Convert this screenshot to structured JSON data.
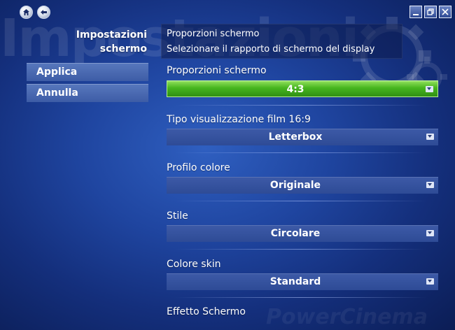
{
  "window": {
    "watermark": "Impostazioni",
    "brand": "PowerCinema"
  },
  "sidebar": {
    "title_line1": "Impostazioni",
    "title_line2": "schermo",
    "apply_label": "Applica",
    "cancel_label": "Annulla"
  },
  "header": {
    "title": "Proporzioni schermo",
    "description": "Selezionare il rapporto di schermo del display"
  },
  "settings": [
    {
      "label": "Proporzioni schermo",
      "value": "4:3",
      "active": true
    },
    {
      "label": "Tipo visualizzazione film 16:9",
      "value": "Letterbox"
    },
    {
      "label": "Profilo colore",
      "value": "Originale"
    },
    {
      "label": "Stile",
      "value": "Circolare"
    },
    {
      "label": "Colore skin",
      "value": "Standard"
    },
    {
      "label": "Effetto Schermo"
    }
  ],
  "colors": {
    "active_green": "#46b51e",
    "dropdown_blue": "#3d5aa7",
    "background": "#1f45a0"
  }
}
